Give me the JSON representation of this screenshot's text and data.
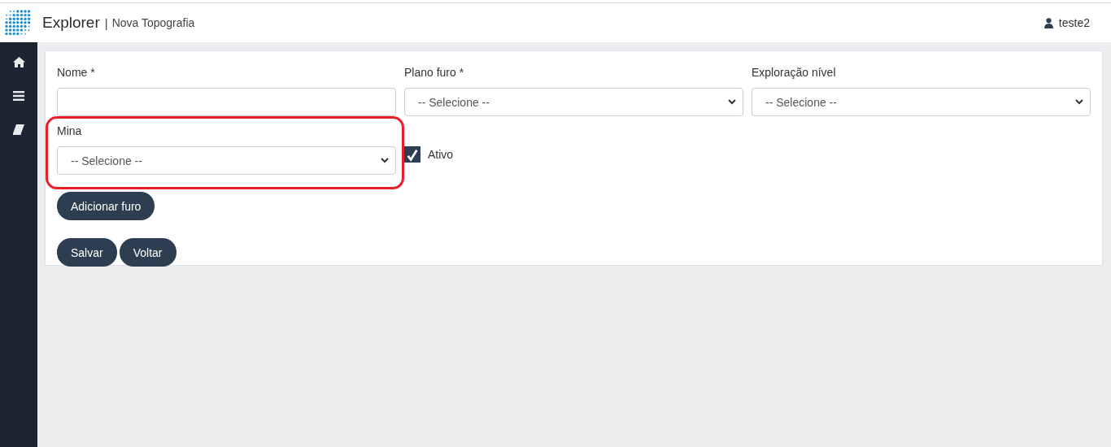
{
  "header": {
    "app_name": "Explorer",
    "separator": "|",
    "page_title": "Nova Topografia",
    "user": "teste2"
  },
  "fields": [
    {
      "kind": "text",
      "label": "Nome *",
      "highlighted": false
    },
    {
      "kind": "select",
      "label": "Plano furo *",
      "value": "-- Selecione --",
      "highlighted": false
    },
    {
      "kind": "select",
      "label": "Exploração nível",
      "value": "-- Selecione --",
      "highlighted": false
    },
    {
      "kind": "select",
      "label": "Mina",
      "value": "-- Selecione --",
      "highlighted": true
    },
    {
      "kind": "checkbox",
      "label": "Ativo",
      "checked": true,
      "highlighted": false
    }
  ],
  "add_button": "Adicionar furo",
  "buttons": [
    "Salvar",
    "Voltar"
  ]
}
